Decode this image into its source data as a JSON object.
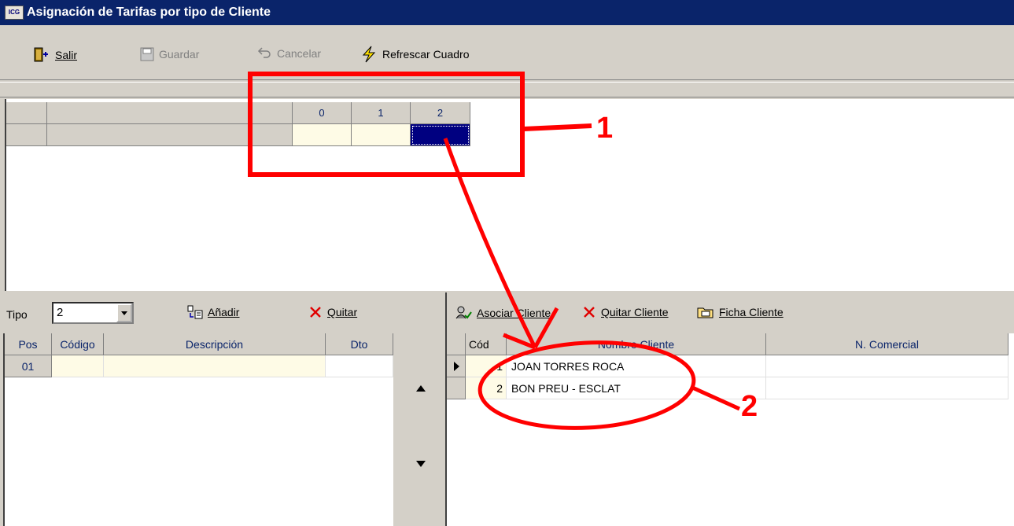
{
  "window": {
    "title": "Asignación de Tarifas por tipo de Cliente",
    "icon_text": "ICG"
  },
  "toolbar": {
    "salir": "Salir",
    "guardar": "Guardar",
    "cancelar": "Cancelar",
    "refrescar": "Refrescar Cuadro"
  },
  "top_grid": {
    "columns": [
      "0",
      "1",
      "2"
    ]
  },
  "left": {
    "tipo_label": "Tipo",
    "tipo_value": "2",
    "anadir": "Añadir",
    "quitar": "Quitar",
    "headers": [
      "Pos",
      "Código",
      "Descripción",
      "Dto"
    ],
    "rows": [
      {
        "pos": "01",
        "codigo": "",
        "descripcion": "",
        "dto": ""
      }
    ]
  },
  "right": {
    "asociar": "Asociar Cliente",
    "quitar_cliente": "Quitar Cliente",
    "ficha": "Ficha Cliente",
    "headers": [
      "Cód",
      "Nombre Cliente",
      "N. Comercial"
    ],
    "rows": [
      {
        "cod": "1",
        "nombre": "JOAN TORRES ROCA",
        "comercial": ""
      },
      {
        "cod": "2",
        "nombre": "BON PREU - ESCLAT",
        "comercial": ""
      }
    ]
  },
  "annotations": {
    "label1": "1",
    "label2": "2",
    "color": "#ff0000"
  },
  "colors": {
    "title_bg": "#0a246a",
    "selected_cell": "#000080",
    "cream": "#fefbe6",
    "face": "#d4d0c8"
  }
}
